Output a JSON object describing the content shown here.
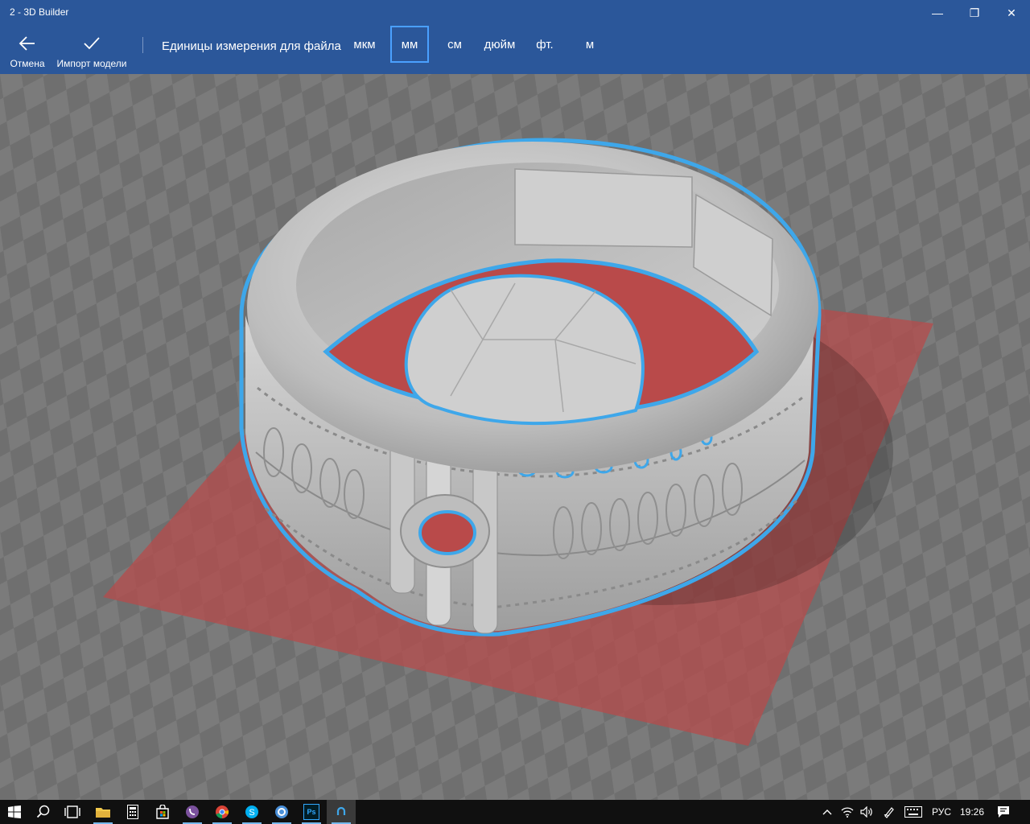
{
  "window": {
    "title": "2 - 3D Builder"
  },
  "window_controls": {
    "minimize": "—",
    "restore": "❐",
    "close": "✕"
  },
  "toolbar": {
    "cancel_label": "Отмена",
    "import_label": "Импорт модели",
    "units_label": "Единицы измерения для файла",
    "units": [
      "мкм",
      "мм",
      "см",
      "дюйм",
      "фт.",
      "м"
    ],
    "selected_unit": "мм"
  },
  "colors": {
    "accent": "#2b579a",
    "selection_outline": "#3ea7ea",
    "build_plate": "#b94a4a",
    "taskbar": "#101010"
  },
  "taskbar": {
    "apps": [
      "windows-start",
      "search",
      "task-view",
      "file-explorer",
      "calculator",
      "store",
      "viber",
      "chrome",
      "skype",
      "app-circle",
      "photoshop",
      "3d-builder"
    ],
    "photoshop_label": "Ps",
    "tray_language": "РУС",
    "tray_time": "19:26"
  }
}
